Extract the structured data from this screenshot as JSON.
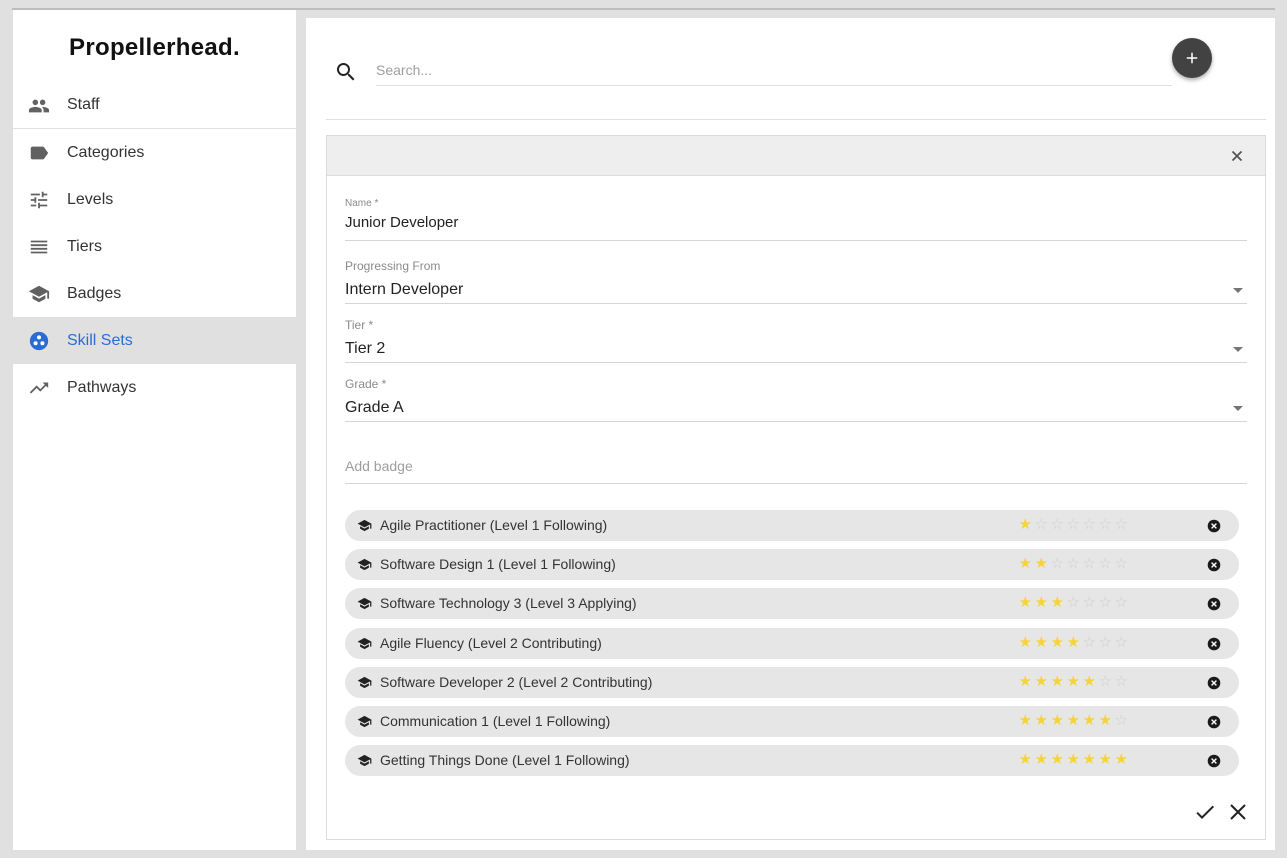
{
  "app": {
    "logo": "Propellerhead."
  },
  "sidebar": {
    "items": [
      {
        "label": "Staff",
        "icon": "people-icon"
      },
      {
        "label": "Categories",
        "icon": "label-icon"
      },
      {
        "label": "Levels",
        "icon": "tune-icon"
      },
      {
        "label": "Tiers",
        "icon": "list-icon"
      },
      {
        "label": "Badges",
        "icon": "school-icon"
      },
      {
        "label": "Skill Sets",
        "icon": "bubble-chart-icon",
        "active": true
      },
      {
        "label": "Pathways",
        "icon": "trending-up-icon"
      }
    ],
    "active_color": "#2b6cd4"
  },
  "search": {
    "placeholder": "Search...",
    "value": ""
  },
  "form": {
    "name": {
      "label": "Name *",
      "value": "Junior Developer"
    },
    "progressing_from": {
      "label": "Progressing From",
      "value": "Intern Developer"
    },
    "tier": {
      "label": "Tier *",
      "value": "Tier 2"
    },
    "grade": {
      "label": "Grade *",
      "value": "Grade A"
    },
    "add_badge": {
      "placeholder": "Add badge"
    }
  },
  "badges": [
    {
      "label": "Agile Practitioner (Level 1 Following)",
      "stars": 1,
      "max_stars": 7
    },
    {
      "label": "Software Design 1 (Level 1 Following)",
      "stars": 2,
      "max_stars": 7
    },
    {
      "label": "Software Technology 3 (Level 3 Applying)",
      "stars": 3,
      "max_stars": 7
    },
    {
      "label": "Agile Fluency (Level 2 Contributing)",
      "stars": 4,
      "max_stars": 7
    },
    {
      "label": "Software Developer 2 (Level 2 Contributing)",
      "stars": 5,
      "max_stars": 7
    },
    {
      "label": "Communication 1 (Level 1 Following)",
      "stars": 6,
      "max_stars": 7
    },
    {
      "label": "Getting Things Done (Level 1 Following)",
      "stars": 7,
      "max_stars": 7
    }
  ],
  "colors": {
    "star_on": "#f5d43b",
    "star_off": "#cfcfcf",
    "fab": "#424242"
  }
}
